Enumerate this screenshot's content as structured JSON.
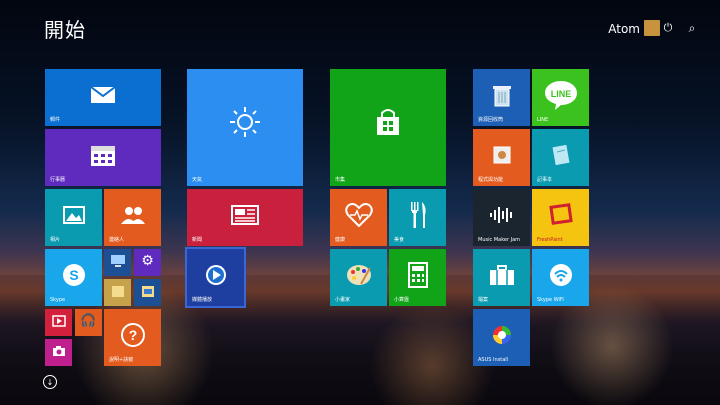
{
  "start": {
    "title": "開始"
  },
  "user": {
    "name": "Atom"
  },
  "tiles": {
    "mail": "郵件",
    "calendar": "行事曆",
    "weather": "天氣",
    "news": "新聞",
    "store": "市集",
    "health": "健康",
    "food": "美食",
    "recycle": "資源回收筒",
    "line": "LINE",
    "photos": "相片",
    "people": "連絡人",
    "onedrive": "OneDrive",
    "desktop_player": "媒體播放",
    "paint": "小畫家",
    "calculator": "小算盤",
    "notepad": "記事本",
    "music_maker": "Music Maker Jam",
    "freshpaint": "FreshPaint",
    "skype": "Skype",
    "help": "說明+訣竅",
    "briefcase": "檔案",
    "skype_wifi": "Skype WiFi",
    "asus_install": "ASUS Install",
    "tools_app": "程式與功能"
  }
}
